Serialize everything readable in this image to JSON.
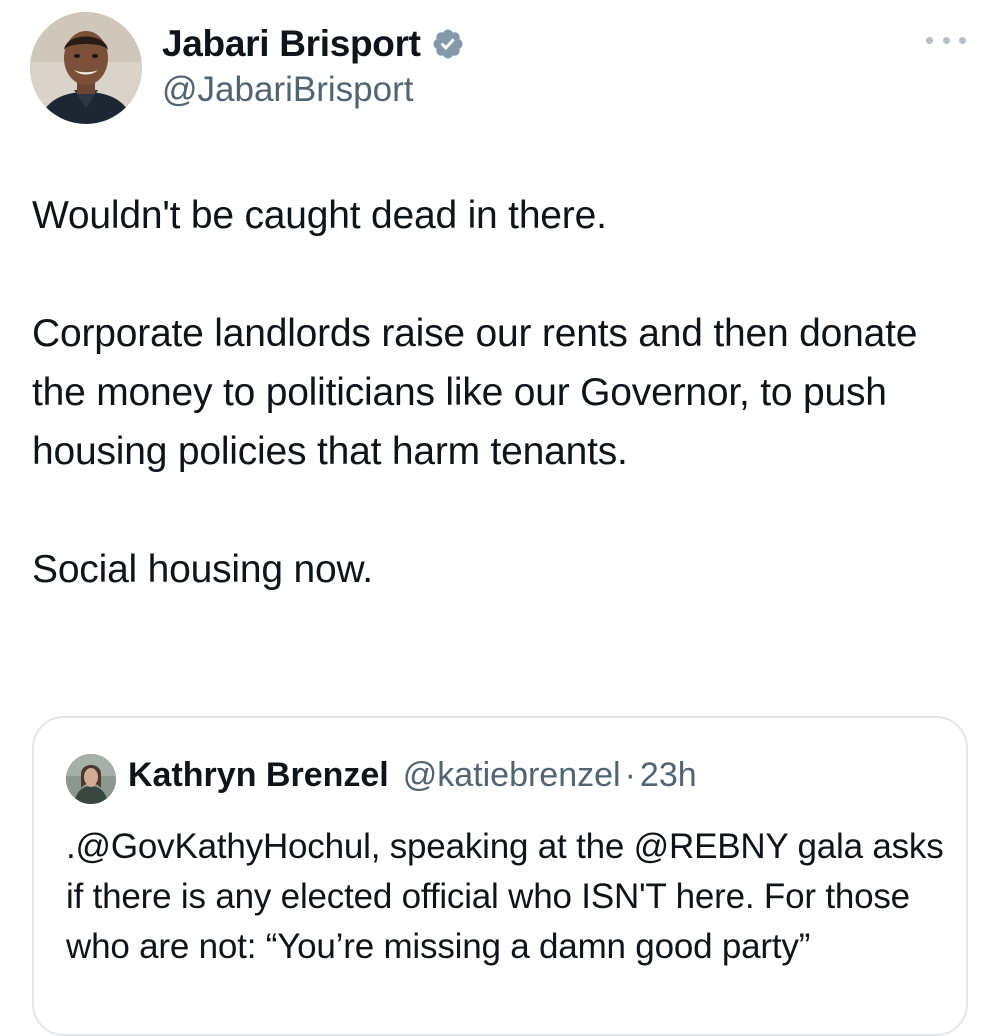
{
  "author": {
    "name": "Jabari Brisport",
    "handle": "@JabariBrisport",
    "verified_color": "#829aab"
  },
  "tweet": {
    "paragraphs": [
      "Wouldn't be caught dead in there.",
      "Corporate landlords raise our rents and then donate the money to politicians like our Governor, to push housing policies that harm tenants.",
      "Social housing now."
    ]
  },
  "quoted_tweet": {
    "name": "Kathryn Brenzel",
    "handle": "@katiebrenzel",
    "separator": "·",
    "time": "23h",
    "text": ".@GovKathyHochul, speaking at the @REBNY gala asks if there is any elected official who ISN'T here. For those who are not: “You’re missing a damn good party”"
  },
  "icons": {
    "more": "more-horizontal-icon",
    "verified": "verified-badge-icon"
  },
  "colors": {
    "text": "#0f1419",
    "secondary": "#536471",
    "border": "#e4e7ea"
  }
}
